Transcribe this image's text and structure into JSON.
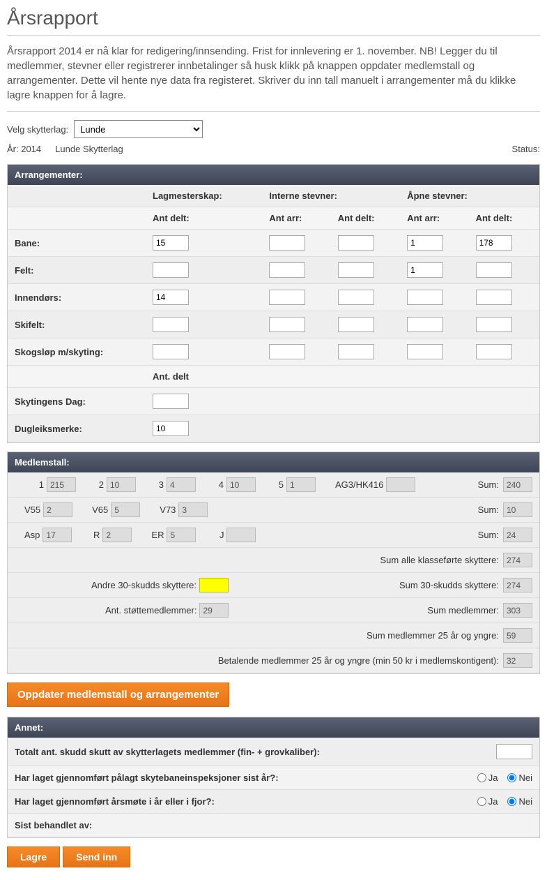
{
  "page": {
    "title": "Årsrapport",
    "intro": "Årsrapport 2014 er nå klar for redigering/innsending. Frist for innlevering er 1. november. NB! Legger du til medlemmer, stevner eller registrerer innbetalinger så husk klikk på knappen oppdater medlemstall og arrangementer. Dette vil hente nye data fra registeret. Skriver du inn tall manuelt i arrangementer må du klikke lagre knappen for å lagre."
  },
  "selector": {
    "label": "Velg skytterlag:",
    "value": "Lunde"
  },
  "info": {
    "year_label": "År: 2014",
    "lag": "Lunde Skytterlag",
    "status_label": "Status:"
  },
  "arr": {
    "header": "Arrangementer:",
    "groups": {
      "lag": "Lagmesterskap:",
      "int": "Interne stevner:",
      "apne": "Åpne stevner:"
    },
    "sub": {
      "ant_delt": "Ant delt:",
      "ant_arr": "Ant arr:"
    },
    "rows": {
      "bane": {
        "label": "Bane:",
        "lag_delt": "15",
        "int_arr": "",
        "int_delt": "",
        "apne_arr": "1",
        "apne_delt": "178"
      },
      "felt": {
        "label": "Felt:",
        "lag_delt": "",
        "int_arr": "",
        "int_delt": "",
        "apne_arr": "1",
        "apne_delt": ""
      },
      "innendors": {
        "label": "Innendørs:",
        "lag_delt": "14",
        "int_arr": "",
        "int_delt": "",
        "apne_arr": "",
        "apne_delt": ""
      },
      "skifelt": {
        "label": "Skifelt:",
        "lag_delt": "",
        "int_arr": "",
        "int_delt": "",
        "apne_arr": "",
        "apne_delt": ""
      },
      "skogslop": {
        "label": "Skogsløp m/skyting:",
        "lag_delt": "",
        "int_arr": "",
        "int_delt": "",
        "apne_arr": "",
        "apne_delt": ""
      }
    },
    "sub2": {
      "ant_delt": "Ant. delt"
    },
    "rows2": {
      "skytingens_dag": {
        "label": "Skytingens Dag:",
        "val": ""
      },
      "dugleiksmerke": {
        "label": "Dugleiksmerke:",
        "val": "10"
      }
    }
  },
  "med": {
    "header": "Medlemstall:",
    "r1": {
      "l1": "1",
      "v1": "215",
      "l2": "2",
      "v2": "10",
      "l3": "3",
      "v3": "4",
      "l4": "4",
      "v4": "10",
      "l5": "5",
      "v5": "1",
      "lag3": "AG3/HK416",
      "vag3": "",
      "sum_l": "Sum:",
      "sum_v": "240"
    },
    "r2": {
      "l1": "V55",
      "v1": "2",
      "l2": "V65",
      "v2": "5",
      "l3": "V73",
      "v3": "3",
      "sum_l": "Sum:",
      "sum_v": "10"
    },
    "r3": {
      "l1": "Asp",
      "v1": "17",
      "l2": "R",
      "v2": "2",
      "l3": "ER",
      "v3": "5",
      "l4": "J",
      "v4": "",
      "sum_l": "Sum:",
      "sum_v": "24"
    },
    "r4": {
      "label": "Sum alle klasseførte skyttere:",
      "val": "274"
    },
    "r5": {
      "label": "Andre 30-skudds skyttere:",
      "val": "",
      "sum_l": "Sum 30-skudds skyttere:",
      "sum_v": "274"
    },
    "r6": {
      "label": "Ant. støttemedlemmer:",
      "val": "29",
      "sum_l": "Sum medlemmer:",
      "sum_v": "303"
    },
    "r7": {
      "label": "Sum medlemmer 25 år og yngre:",
      "val": "59"
    },
    "r8": {
      "label": "Betalende medlemmer 25 år og yngre (min 50 kr i medlemskontigent):",
      "val": "32"
    }
  },
  "buttons": {
    "oppdater": "Oppdater medlemstall og arrangementer",
    "lagre": "Lagre",
    "send_inn": "Send inn"
  },
  "annet": {
    "header": "Annet:",
    "q1": "Totalt ant. skudd skutt av skytterlagets medlemmer (fin- + grovkaliber):",
    "q2": "Har laget gjennomført pålagt skytebaneinspeksjoner sist år?:",
    "q3": "Har laget gjennomført årsmøte i år eller i fjor?:",
    "q4": "Sist behandlet av:",
    "ja": "Ja",
    "nei": "Nei"
  }
}
